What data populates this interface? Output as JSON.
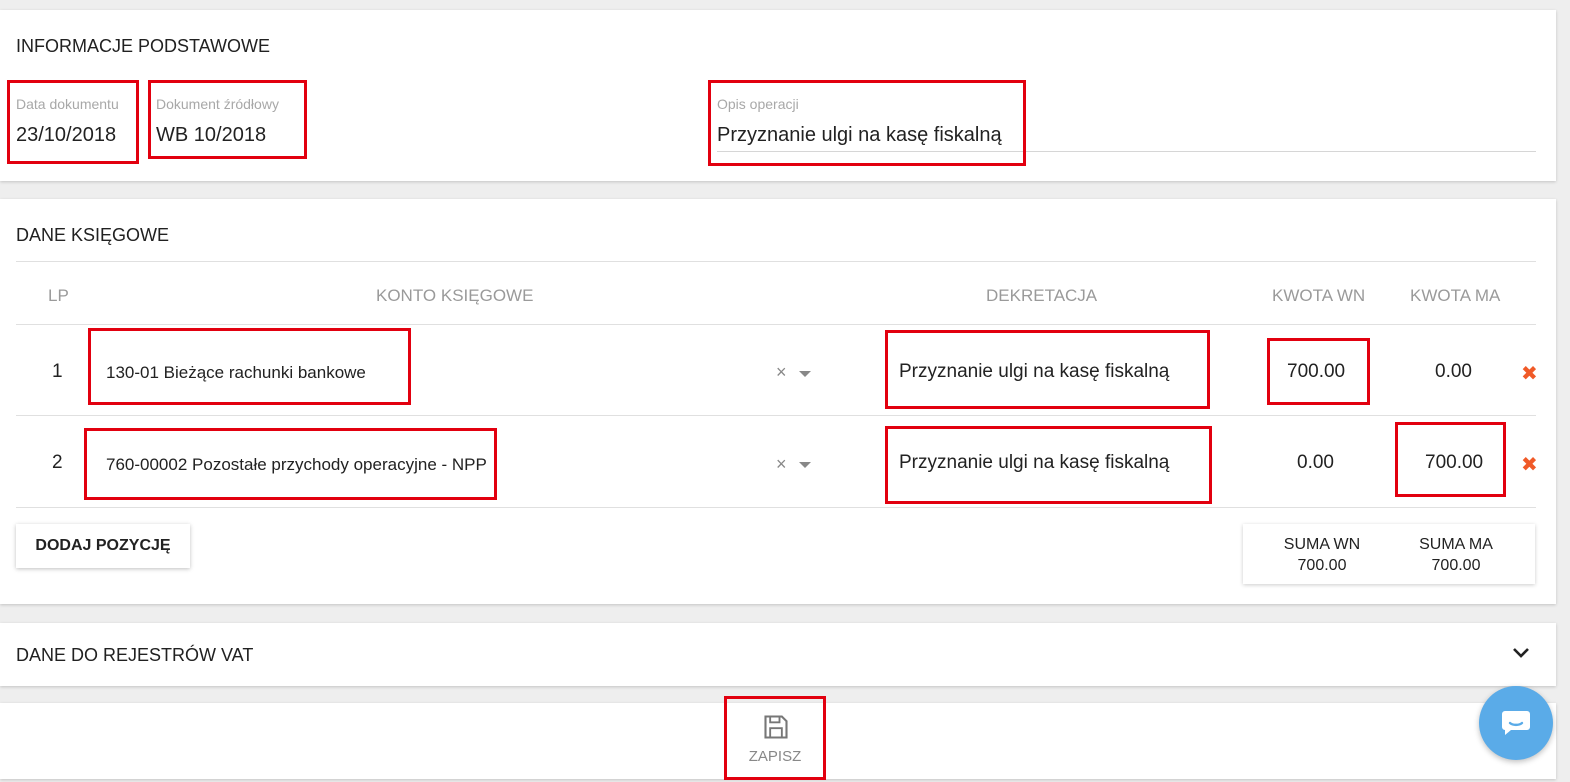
{
  "basic_info": {
    "title": "INFORMACJE PODSTAWOWE",
    "doc_date_label": "Data dokumentu",
    "doc_date_value": "23/10/2018",
    "source_doc_label": "Dokument źródłowy",
    "source_doc_value": "WB 10/2018",
    "description_label": "Opis operacji",
    "description_value": "Przyznanie ulgi na kasę fiskalną"
  },
  "accounting": {
    "title": "DANE KSIĘGOWE",
    "columns": [
      "LP",
      "KONTO KSIĘGOWE",
      "DEKRETACJA",
      "KWOTA WN",
      "KWOTA MA"
    ],
    "rows": [
      {
        "lp": "1",
        "account": "130-01 Bieżące rachunki bankowe",
        "decree": "Przyznanie ulgi na kasę fiskalną",
        "wn": "700.00",
        "ma": "0.00"
      },
      {
        "lp": "2",
        "account": "760-00002 Pozostałe przychody operacyjne - NPP",
        "decree": "Przyznanie ulgi na kasę fiskalną",
        "wn": "0.00",
        "ma": "700.00"
      }
    ],
    "add_button": "DODAJ POZYCJĘ",
    "sum_wn_label": "SUMA WN",
    "sum_wn_value": "700.00",
    "sum_ma_label": "SUMA MA",
    "sum_ma_value": "700.00",
    "clear_glyph": "×",
    "delete_glyph": "✖"
  },
  "vat": {
    "title": "DANE DO REJESTRÓW VAT"
  },
  "footer": {
    "save_label": "ZAPISZ"
  },
  "icons": {
    "save": "floppy-disk-icon",
    "chat": "chat-bubble-icon",
    "expand": "chevron-down-icon",
    "clear": "close-icon",
    "delete": "delete-icon"
  },
  "colors": {
    "highlight": "#e2000f",
    "delete": "#f05a28",
    "chat_fab": "#5aabe8"
  }
}
